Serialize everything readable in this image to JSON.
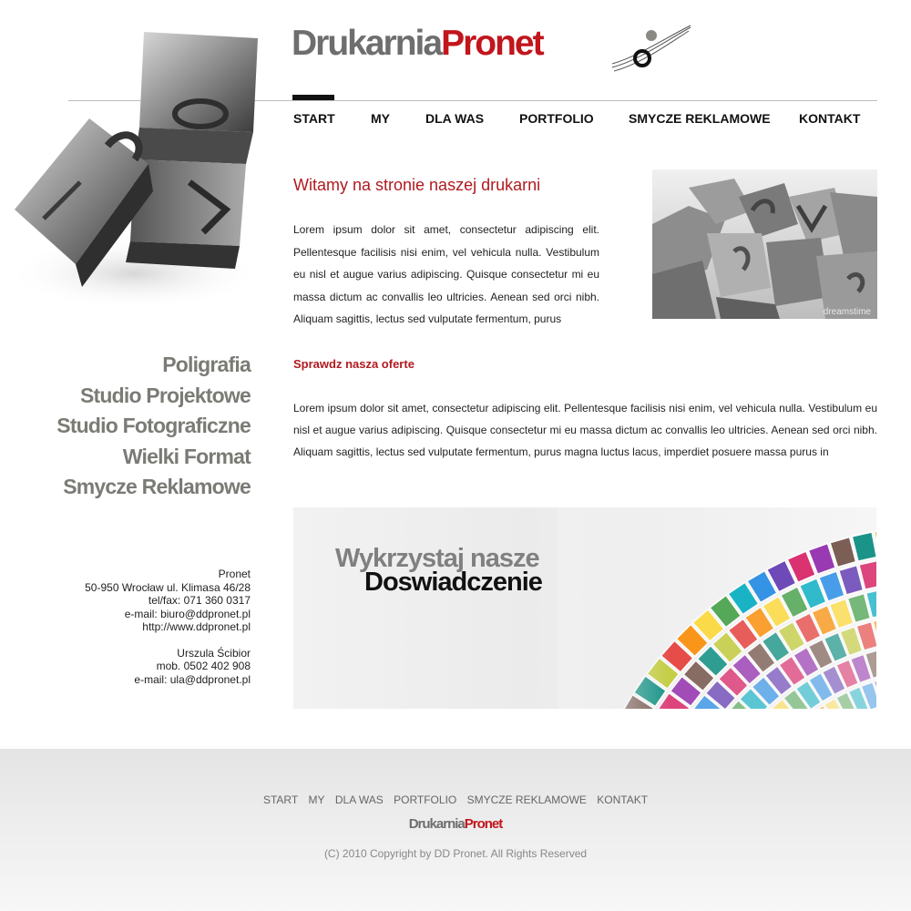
{
  "header": {
    "logo": {
      "part1": "Drukarnia",
      "part2": "Pronet"
    },
    "nav": [
      {
        "label": "START",
        "active": true
      },
      {
        "label": "MY"
      },
      {
        "label": "DLA WAS"
      },
      {
        "label": "PORTFOLIO"
      },
      {
        "label": "SMYCZE REKLAMOWE"
      },
      {
        "label": "KONTAKT"
      }
    ]
  },
  "sidebar": {
    "services": [
      "Poligrafia",
      "Studio Projektowe",
      "Studio Fotograficzne",
      "Wielki Format",
      "Smycze Reklamowe"
    ],
    "contact": {
      "company": "Pronet",
      "address": "50-950 Wrocław ul. Klimasa 46/28",
      "phone": "tel/fax: 071 360 0317",
      "email": "e-mail: biuro@ddpronet.pl",
      "web": "http://www.ddpronet.pl",
      "person": "Urszula Ścibior",
      "mobile": "mob. 0502 402 908",
      "person_email": "e-mail: ula@ddpronet.pl"
    }
  },
  "main": {
    "welcome_title": "Witamy na stronie naszej drukarni",
    "paragraph1": "Lorem ipsum dolor sit amet, consectetur adipiscing elit. Pellentesque facilisis nisi enim, vel vehicula nulla. Vestibulum eu nisl et augue varius adipiscing. Quisque consectetur mi eu massa dictum ac convallis leo ultricies. Aenean sed orci nibh. Aliquam sagittis, lectus sed vulputate fermentum, purus",
    "photo_watermark": "dreamstime",
    "offer_title": "Sprawdz nasza oferte",
    "paragraph2": "Lorem ipsum dolor sit amet, consectetur adipiscing elit. Pellentesque facilisis nisi enim, vel vehicula nulla. Vestibulum eu nisl et augue varius adipiscing. Quisque consectetur mi eu massa dictum ac convallis leo ultricies. Aenean sed orci nibh. Aliquam sagittis, lectus sed vulputate fermentum, purus magna luctus lacus, imperdiet posuere massa purus in",
    "banner": {
      "line1": "Wykrzystaj nasze",
      "line2": "Doswiadczenie"
    }
  },
  "footer": {
    "nav": [
      "START",
      "MY",
      "DLA WAS",
      "PORTFOLIO",
      "SMYCZE REKLAMOWE",
      "KONTAKT"
    ],
    "logo": {
      "part1": "Drukarnia",
      "part2": "Pronet"
    },
    "copyright": "(C) 2010 Copyright by DD Pronet. All Rights Reserved"
  },
  "colors": {
    "accent": "#b01a1f",
    "logo_red": "#c2151c",
    "logo_gray": "#6e6e6e",
    "service_gray": "#7b7b76"
  }
}
